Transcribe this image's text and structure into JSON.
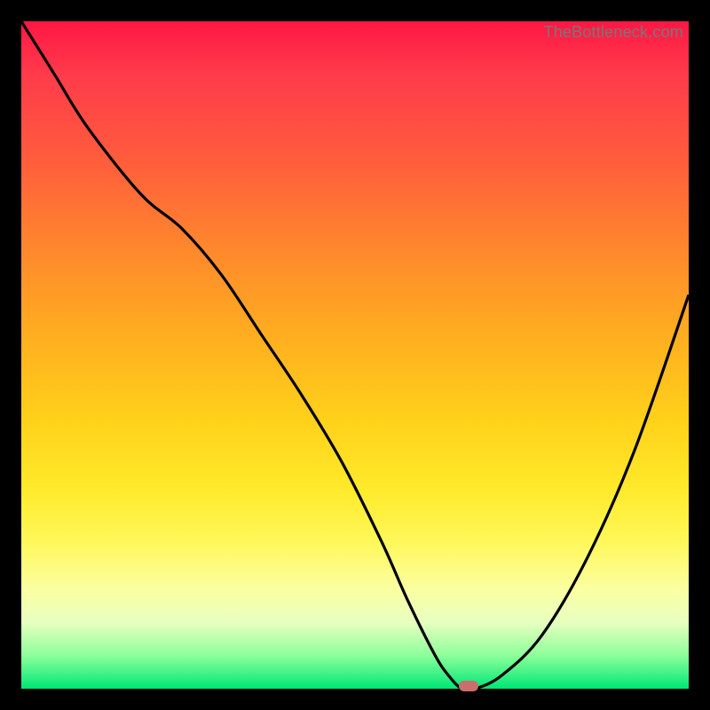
{
  "watermark": "TheBottleneck.com",
  "chart_data": {
    "type": "line",
    "title": "",
    "xlabel": "",
    "ylabel": "",
    "xlim": [
      0,
      100
    ],
    "ylim": [
      0,
      100
    ],
    "grid": false,
    "legend": false,
    "series": [
      {
        "name": "curve",
        "x": [
          0,
          5,
          10,
          18,
          24,
          30,
          36,
          42,
          48,
          54,
          58,
          62,
          64,
          66,
          68,
          72,
          78,
          85,
          92,
          100
        ],
        "y": [
          100,
          92,
          84,
          74,
          69,
          62,
          53,
          44,
          34,
          22,
          13,
          5,
          2,
          0,
          0,
          2,
          8,
          20,
          36,
          59
        ]
      }
    ],
    "marker": {
      "x": 67,
      "y": 0,
      "color": "#cc6e6e"
    },
    "background_gradient": {
      "direction": "top-to-bottom",
      "stops": [
        {
          "pos": 0.0,
          "color": "#ff1744"
        },
        {
          "pos": 0.35,
          "color": "#ff8a2b"
        },
        {
          "pos": 0.7,
          "color": "#ffe92a"
        },
        {
          "pos": 0.9,
          "color": "#e8ffc0"
        },
        {
          "pos": 1.0,
          "color": "#00e676"
        }
      ]
    }
  }
}
